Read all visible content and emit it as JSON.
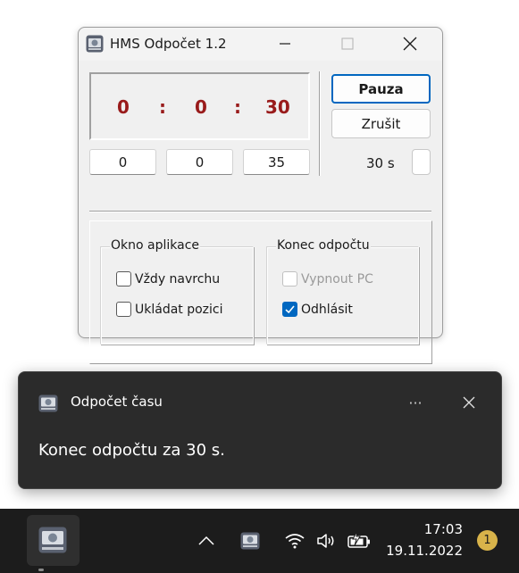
{
  "window": {
    "title": "HMS Odpočet 1.2",
    "icon": "hms-app-icon",
    "minimize_icon": "minimize-icon",
    "maximize_icon": "maximize-icon",
    "close_icon": "close-icon"
  },
  "timer": {
    "hours": "0",
    "minutes": "0",
    "seconds": "30",
    "separator": ":"
  },
  "inputs": {
    "hours": "0",
    "minutes": "0",
    "seconds": "35"
  },
  "buttons": {
    "pause": "Pauza",
    "cancel": "Zrušit"
  },
  "seconds_label": "30 s",
  "groups": {
    "app_window": {
      "legend": "Okno aplikace",
      "always_on_top": {
        "label": "Vždy navrchu",
        "checked": false
      },
      "save_position": {
        "label": "Ukládat pozici",
        "checked": false
      }
    },
    "countdown_end": {
      "legend": "Konec odpočtu",
      "shutdown_pc": {
        "label": "Vypnout PC",
        "checked": false,
        "disabled": true
      },
      "log_off": {
        "label": "Odhlásit",
        "checked": true
      }
    }
  },
  "toast": {
    "app_name": "Odpočet času",
    "more": "···",
    "message": "Konec odpočtu za 30 s."
  },
  "taskbar": {
    "clock_time": "17:03",
    "clock_date": "19.11.2022",
    "notification_count": "1"
  },
  "colors": {
    "timer_digits": "#991b1b",
    "accent": "#0067c0",
    "toast_bg": "#2b2b2b",
    "taskbar_bg": "#1c1c1c",
    "badge": "#d8b34a"
  }
}
